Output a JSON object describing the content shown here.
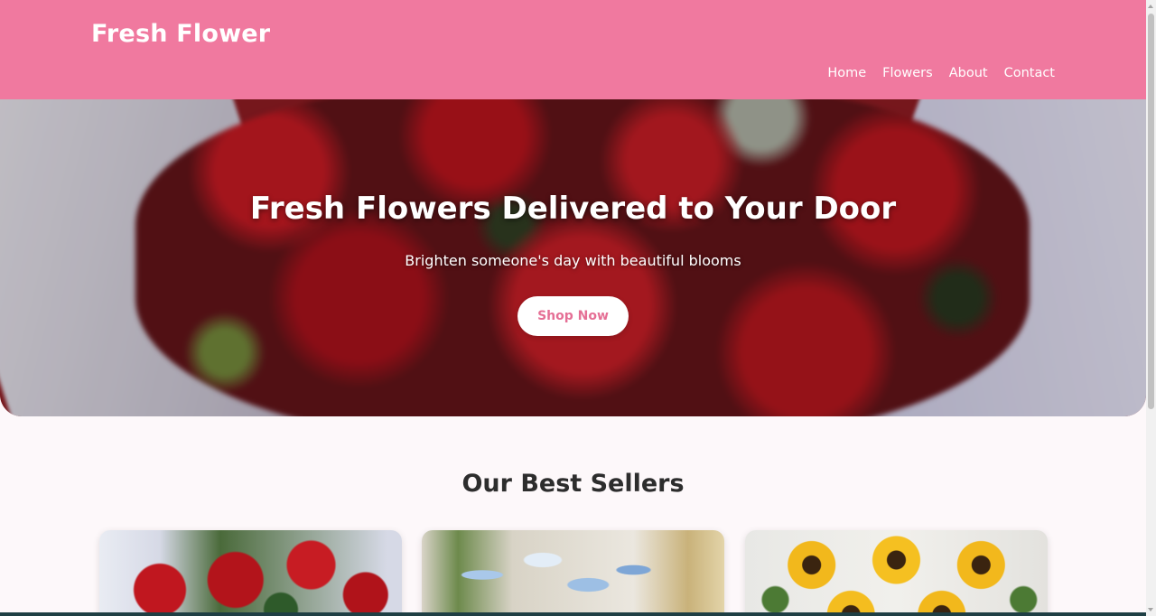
{
  "header": {
    "logo": "Fresh Flower",
    "nav": [
      "Home",
      "Flowers",
      "About",
      "Contact"
    ]
  },
  "hero": {
    "title": "Fresh Flowers Delivered to Your Door",
    "subtitle": "Brighten someone's day with beautiful blooms",
    "cta_label": "Shop Now"
  },
  "best_sellers": {
    "title": "Our Best Sellers"
  },
  "colors": {
    "brand_pink": "#f0799f",
    "cta_text": "#e56f95",
    "heading_text": "#2d2d2d",
    "page_background": "#fdf8fa"
  }
}
